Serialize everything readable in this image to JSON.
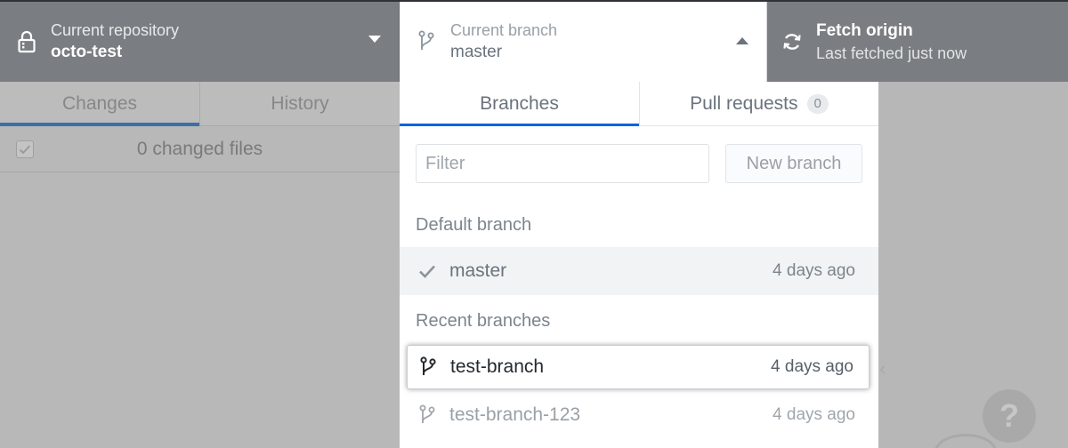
{
  "toolbar": {
    "repository": {
      "label": "Current repository",
      "value": "octo-test",
      "icon": "lock-icon"
    },
    "branch": {
      "label": "Current branch",
      "value": "master",
      "icon": "git-branch-icon"
    },
    "fetch": {
      "label": "Fetch origin",
      "status": "Last fetched just now",
      "icon": "sync-icon"
    }
  },
  "left_panel": {
    "tabs": [
      {
        "label": "Changes",
        "active": true
      },
      {
        "label": "History",
        "active": false
      }
    ],
    "changes_count_label": "0 changed files"
  },
  "dropdown": {
    "tabs": [
      {
        "label": "Branches",
        "active": true
      },
      {
        "label": "Pull requests",
        "count": "0"
      }
    ],
    "filter": {
      "placeholder": "Filter",
      "value": ""
    },
    "new_branch_label": "New branch",
    "default_header": "Default branch",
    "recent_header": "Recent branches",
    "branches": [
      {
        "name": "master",
        "time": "4 days ago",
        "icon": "check-icon"
      },
      {
        "name": "test-branch",
        "time": "4 days ago",
        "icon": "git-branch-icon"
      },
      {
        "name": "test-branch-123",
        "time": "4 days ago",
        "icon": "git-branch-icon"
      }
    ]
  },
  "help_label": "?",
  "colors": {
    "toolbar_bg": "#7a7e82",
    "accent_blue": "#0366d6",
    "overlay_gray": "#b8b8b8"
  }
}
